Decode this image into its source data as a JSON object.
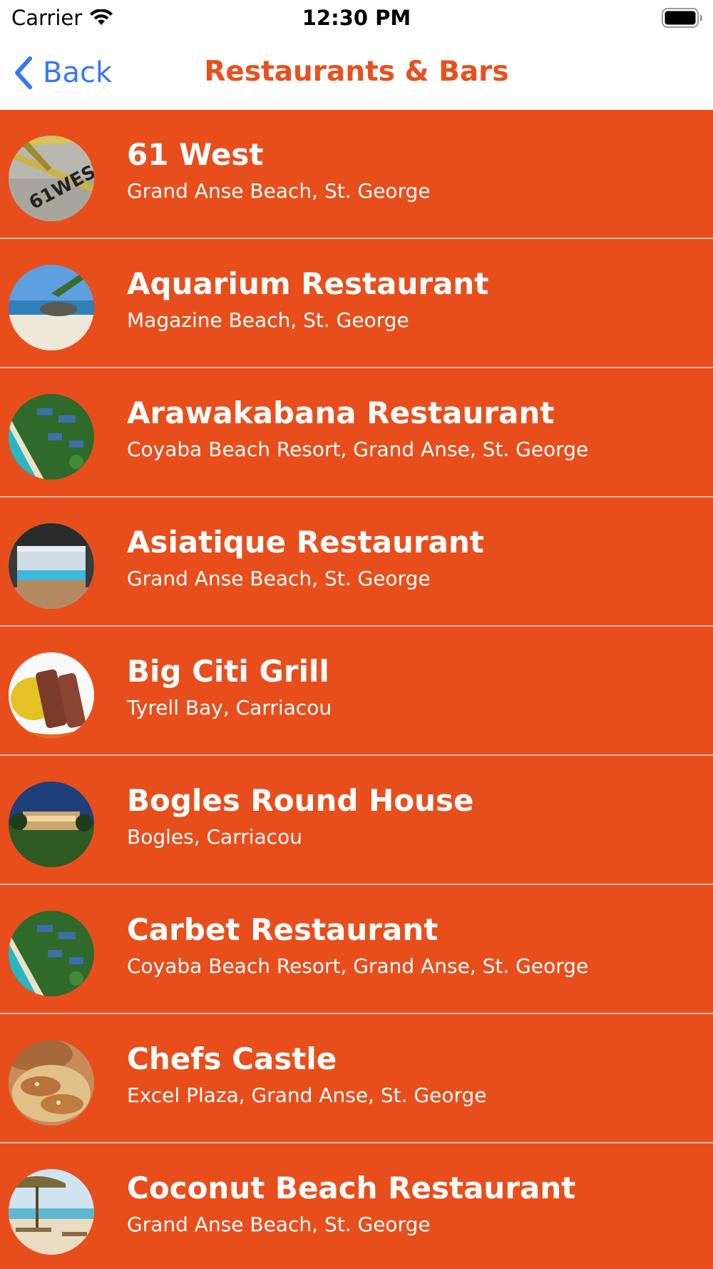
{
  "status_bar": {
    "carrier": "Carrier",
    "time": "12:30 PM"
  },
  "nav": {
    "back_label": "Back",
    "title": "Restaurants & Bars"
  },
  "colors": {
    "accent": "#e84e1c",
    "back_blue": "#3478f6"
  },
  "restaurants": [
    {
      "name": "61 West",
      "location": "Grand Anse Beach, St. George"
    },
    {
      "name": "Aquarium Restaurant",
      "location": "Magazine Beach, St. George"
    },
    {
      "name": "Arawakabana Restaurant",
      "location": "Coyaba Beach Resort, Grand Anse, St. George"
    },
    {
      "name": "Asiatique Restaurant",
      "location": "Grand Anse Beach, St. George"
    },
    {
      "name": "Big Citi Grill",
      "location": "Tyrell Bay, Carriacou"
    },
    {
      "name": "Bogles Round House",
      "location": "Bogles, Carriacou"
    },
    {
      "name": "Carbet Restaurant",
      "location": "Coyaba Beach Resort, Grand Anse, St. George"
    },
    {
      "name": "Chefs Castle",
      "location": "Excel Plaza, Grand Anse, St. George"
    },
    {
      "name": "Coconut Beach Restaurant",
      "location": "Grand Anse Beach, St. George"
    }
  ]
}
